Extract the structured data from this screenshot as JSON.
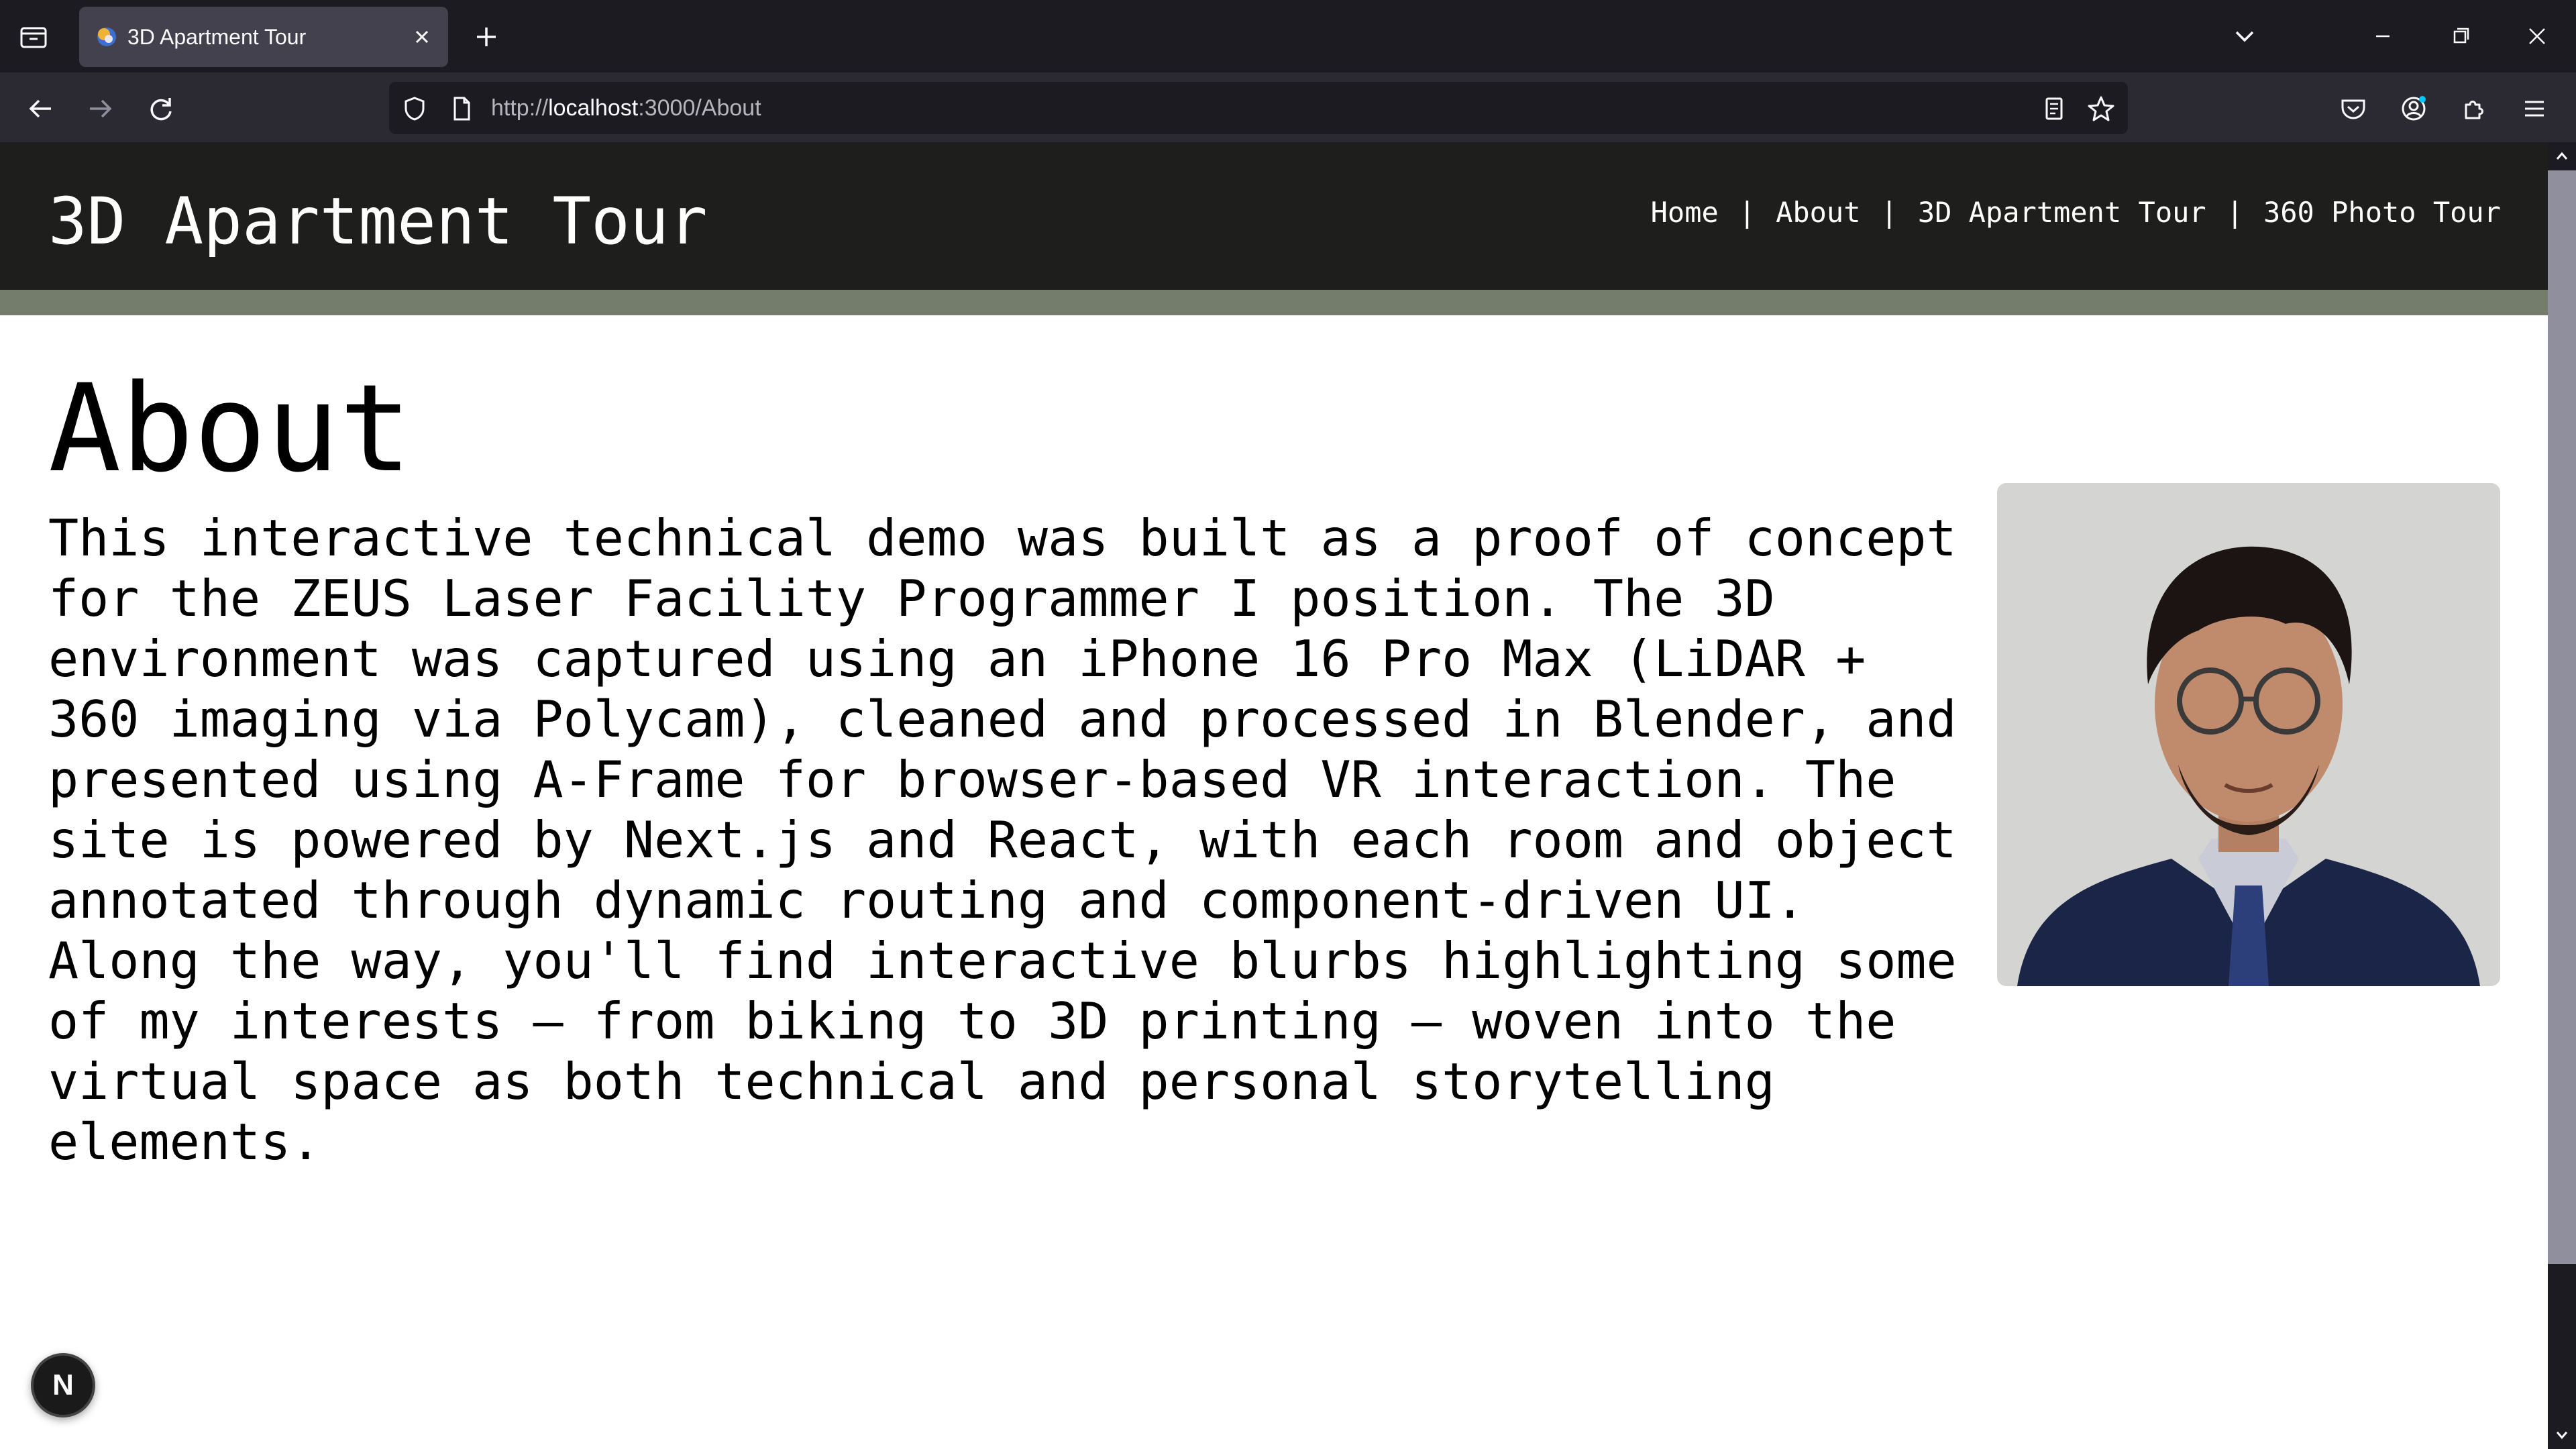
{
  "browser": {
    "tab": {
      "title": "3D Apartment Tour"
    },
    "url": {
      "scheme": "http://",
      "host": "localhost",
      "rest": ":3000/About"
    }
  },
  "site": {
    "title": "3D Apartment Tour",
    "nav": {
      "home": "Home",
      "about": "About",
      "tour3d": "3D Apartment Tour",
      "photo360": "360 Photo Tour",
      "separator": "|"
    }
  },
  "page": {
    "heading": "About",
    "body": "This interactive technical demo was built as a proof of concept for the ZEUS Laser Facility Programmer I position. The 3D environment was captured using an iPhone 16 Pro Max (LiDAR + 360 imaging via Polycam), cleaned and processed in Blender, and presented using A-Frame for browser-based VR interaction. The site is powered by Next.js and React, with each room and object annotated through dynamic routing and component-driven UI. Along the way, you'll find interactive blurbs highlighting some of my interests — from biking to 3D printing — woven into the virtual space as both technical and personal storytelling elements."
  },
  "dev": {
    "badge": "N"
  },
  "colors": {
    "header": "#1e1f1c",
    "accent": "#747d6c",
    "chrome": "#2b2a33"
  }
}
